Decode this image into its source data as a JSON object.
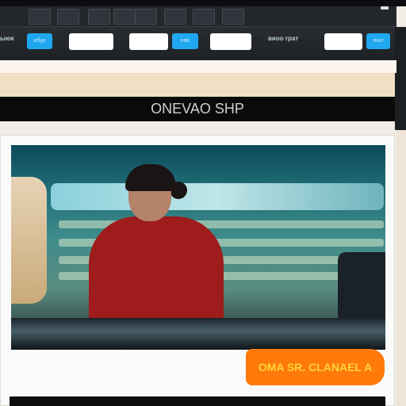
{
  "toolbar": {
    "tools": [
      "tool-1",
      "tool-2",
      "tool-3",
      "tool-4",
      "tool-5",
      "tool-6",
      "tool-7",
      "tool-8"
    ]
  },
  "controls": {
    "left_label": "ыюк",
    "blue1": "ибур",
    "blue2": "ввв",
    "blue3": "вмл",
    "mid_label": "виоо грат"
  },
  "page": {
    "title": "ONEVAO SHP",
    "cta_label": "OMA SR. CLANAEL A"
  },
  "colors": {
    "accent_blue": "#1fa7ef",
    "cta_orange": "#ff7a0a"
  }
}
